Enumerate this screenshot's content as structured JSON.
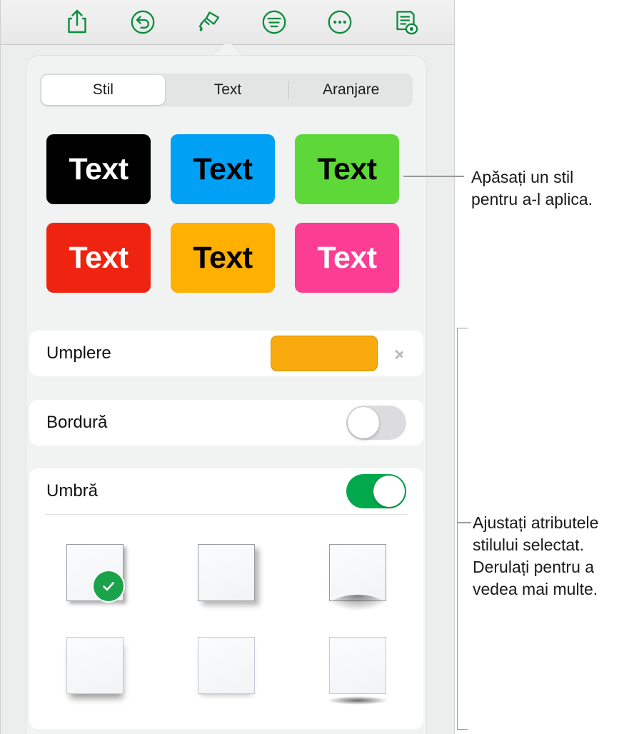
{
  "toolbar": {
    "buttons": [
      {
        "name": "share-icon",
        "label": "Partajare"
      },
      {
        "name": "undo-icon",
        "label": "Anulare"
      },
      {
        "name": "format-brush-icon",
        "label": "Format"
      },
      {
        "name": "paragraph-icon",
        "label": "Paragraf"
      },
      {
        "name": "more-icon",
        "label": "Mai multe"
      },
      {
        "name": "document-preview-icon",
        "label": "Previzualizare document"
      }
    ]
  },
  "popover": {
    "tabs": [
      {
        "label": "Stil",
        "active": true
      },
      {
        "label": "Text",
        "active": false
      },
      {
        "label": "Aranjare",
        "active": false
      }
    ],
    "text_styles": [
      {
        "label": "Text",
        "bg": "#000000",
        "fg": "#ffffff"
      },
      {
        "label": "Text",
        "bg": "#00a0f5",
        "fg": "#000000"
      },
      {
        "label": "Text",
        "bg": "#5ed839",
        "fg": "#000000"
      },
      {
        "label": "Text",
        "bg": "#ee2310",
        "fg": "#ffffff"
      },
      {
        "label": "Text",
        "bg": "#ffb000",
        "fg": "#000000"
      },
      {
        "label": "Text",
        "bg": "#fc3d94",
        "fg": "#ffffff"
      }
    ],
    "fill_row": {
      "label": "Umplere",
      "swatch_color": "#f9ab0e",
      "chevron": "chevron-right-icon"
    },
    "border_row": {
      "label": "Bordură",
      "toggle_on": false
    },
    "shadow_row": {
      "label": "Umbră",
      "toggle_on": true,
      "toggle_on_color": "#01a94c"
    },
    "shadow_styles": [
      {
        "name": "shadow-style-drop",
        "selected": true
      },
      {
        "name": "shadow-style-drop-large",
        "selected": false
      },
      {
        "name": "shadow-style-curl",
        "selected": false
      },
      {
        "name": "shadow-style-contact",
        "selected": false
      },
      {
        "name": "shadow-style-soft",
        "selected": false
      },
      {
        "name": "shadow-style-floating",
        "selected": false
      }
    ]
  },
  "callouts": [
    {
      "name": "callout-apply-style",
      "text": "Apăsați un stil\npentru a-l aplica."
    },
    {
      "name": "callout-adjust-attributes",
      "text": "Ajustați atributele\nstilului selectat.\nDerulați pentru a\nvedea mai multe."
    }
  ]
}
